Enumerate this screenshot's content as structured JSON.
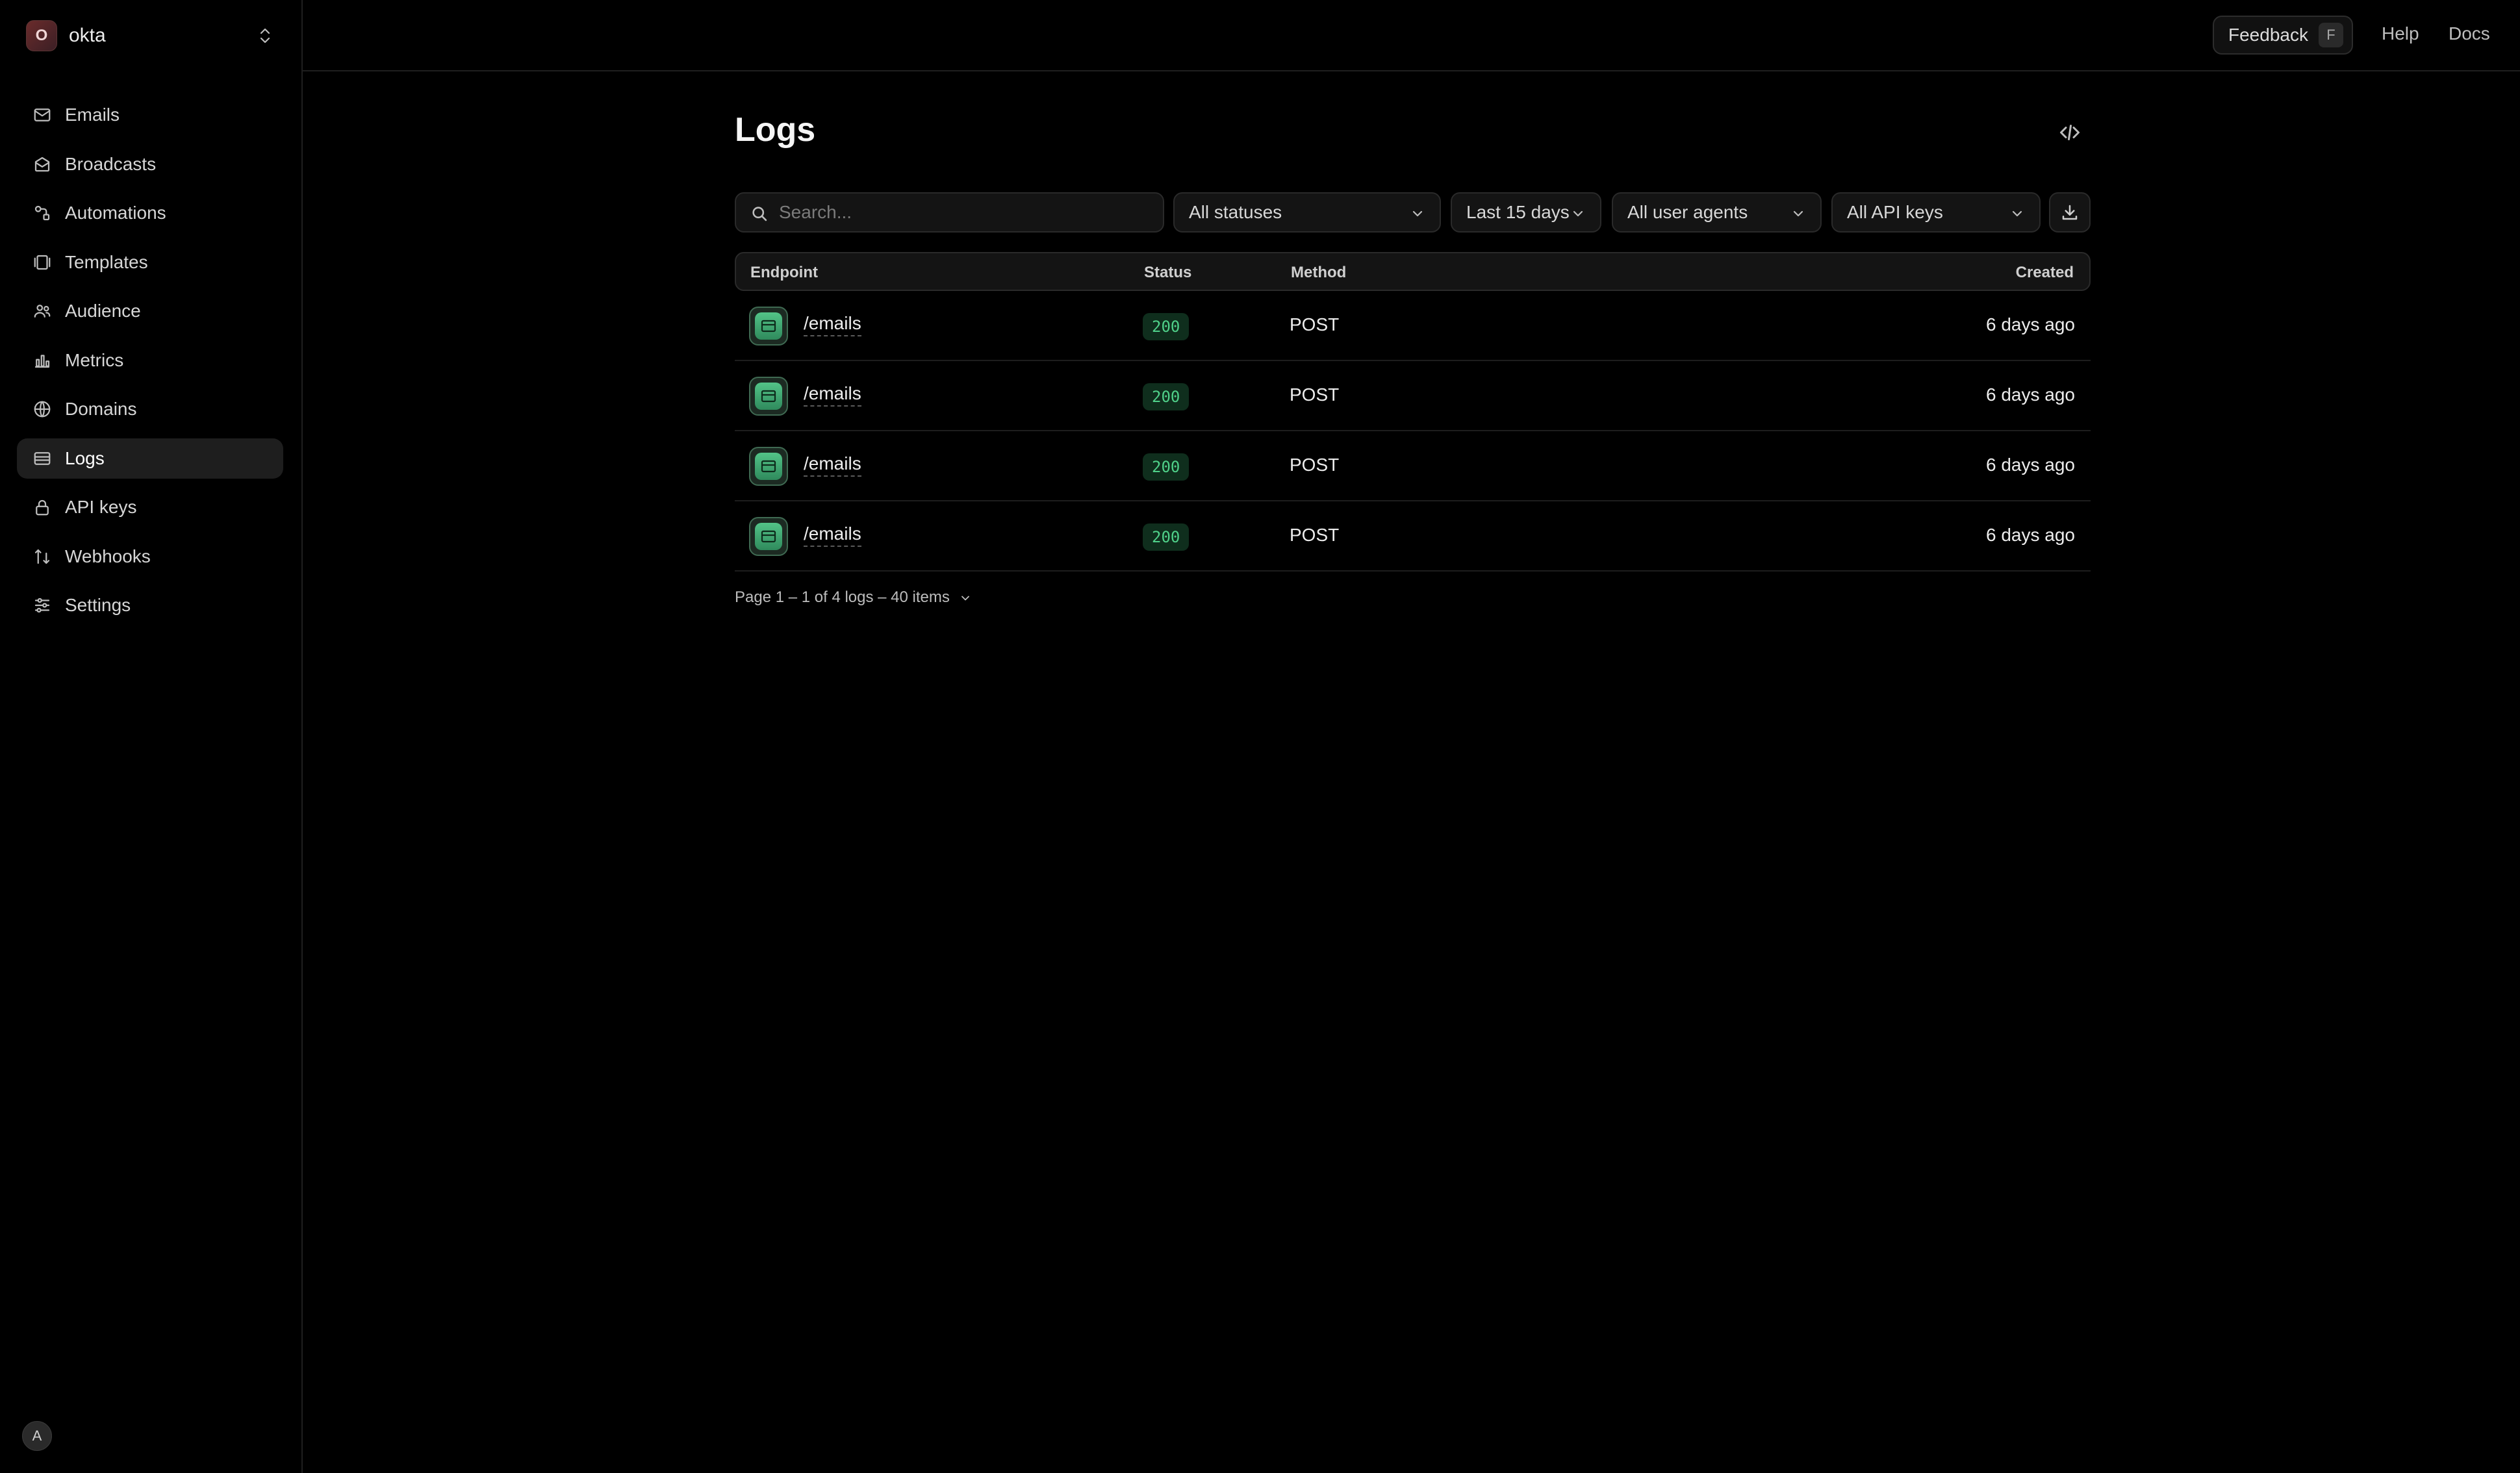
{
  "workspace": {
    "initial": "O",
    "name": "okta"
  },
  "sidebar": {
    "items": [
      {
        "label": "Emails",
        "icon": "mail-icon"
      },
      {
        "label": "Broadcasts",
        "icon": "broadcast-icon"
      },
      {
        "label": "Automations",
        "icon": "automation-icon"
      },
      {
        "label": "Templates",
        "icon": "template-icon"
      },
      {
        "label": "Audience",
        "icon": "audience-icon"
      },
      {
        "label": "Metrics",
        "icon": "chart-icon"
      },
      {
        "label": "Domains",
        "icon": "globe-icon"
      },
      {
        "label": "Logs",
        "icon": "logs-icon",
        "active": true
      },
      {
        "label": "API keys",
        "icon": "lock-icon"
      },
      {
        "label": "Webhooks",
        "icon": "webhook-icon"
      },
      {
        "label": "Settings",
        "icon": "sliders-icon"
      }
    ],
    "user_initial": "A"
  },
  "topbar": {
    "feedback_label": "Feedback",
    "feedback_shortcut": "F",
    "help_label": "Help",
    "docs_label": "Docs"
  },
  "page": {
    "title": "Logs"
  },
  "filters": {
    "search_placeholder": "Search...",
    "status": "All statuses",
    "date_range": "Last 15 days",
    "user_agent": "All user agents",
    "api_key": "All API keys"
  },
  "table": {
    "columns": {
      "endpoint": "Endpoint",
      "status": "Status",
      "method": "Method",
      "created": "Created"
    },
    "rows": [
      {
        "endpoint": "/emails",
        "status": "200",
        "method": "POST",
        "created": "6 days ago"
      },
      {
        "endpoint": "/emails",
        "status": "200",
        "method": "POST",
        "created": "6 days ago"
      },
      {
        "endpoint": "/emails",
        "status": "200",
        "method": "POST",
        "created": "6 days ago"
      },
      {
        "endpoint": "/emails",
        "status": "200",
        "method": "POST",
        "created": "6 days ago"
      }
    ]
  },
  "pagination": {
    "text": "Page 1 – 1 of 4 logs – 40 items"
  },
  "colors": {
    "accent_green": "#4fd089",
    "background": "#000000",
    "surface": "#141414"
  }
}
